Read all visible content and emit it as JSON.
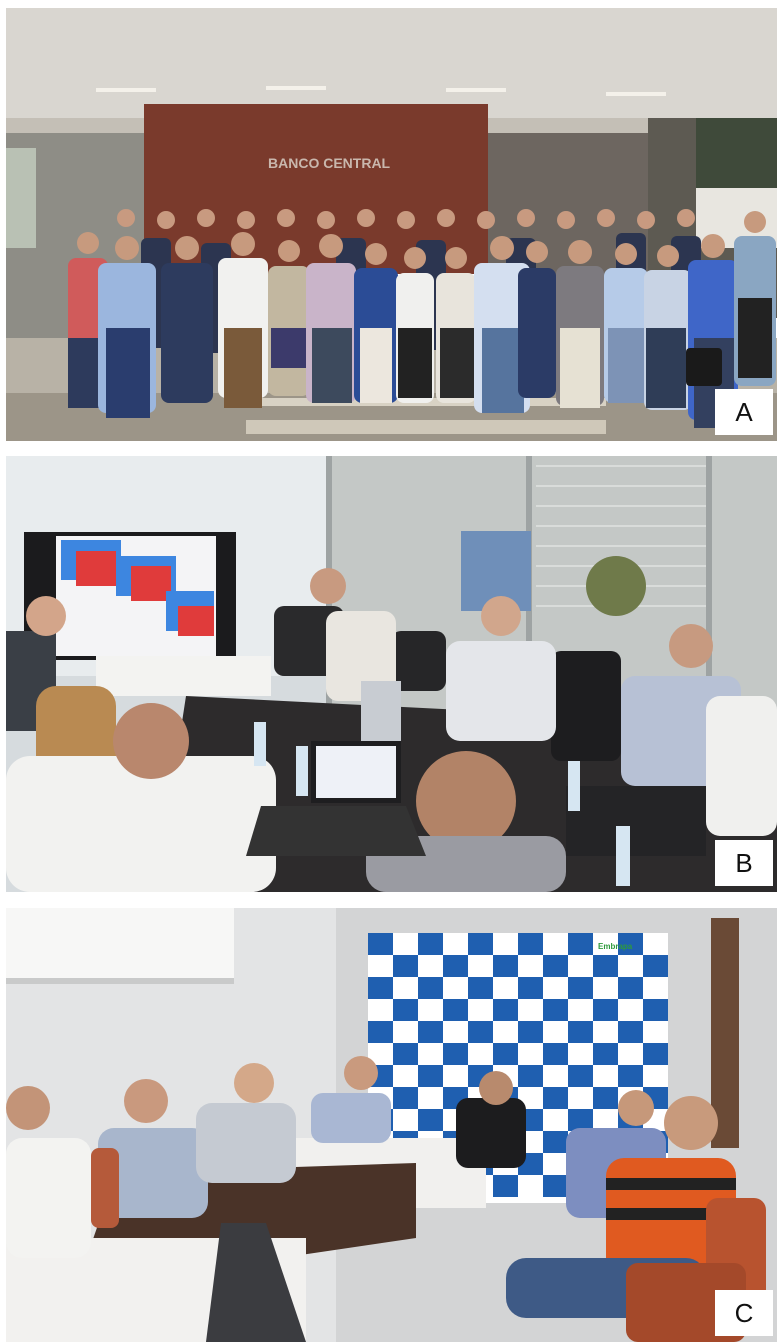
{
  "panels": [
    {
      "id": "A",
      "label": "A",
      "scene": "group-photo",
      "sign": {
        "text": "BANCO CENTRAL",
        "subtitle": ""
      }
    },
    {
      "id": "B",
      "label": "B",
      "scene": "meeting-room"
    },
    {
      "id": "C",
      "label": "C",
      "scene": "meeting-room-banner",
      "banner_logo_text": "Embrapa"
    }
  ],
  "colors": {
    "frame_bg": "#ffffff",
    "label_bg": "#ffffff",
    "banner_blue": "#1f5fb0",
    "map_red": "#e03b3b",
    "map_blue": "#3d86e0"
  }
}
